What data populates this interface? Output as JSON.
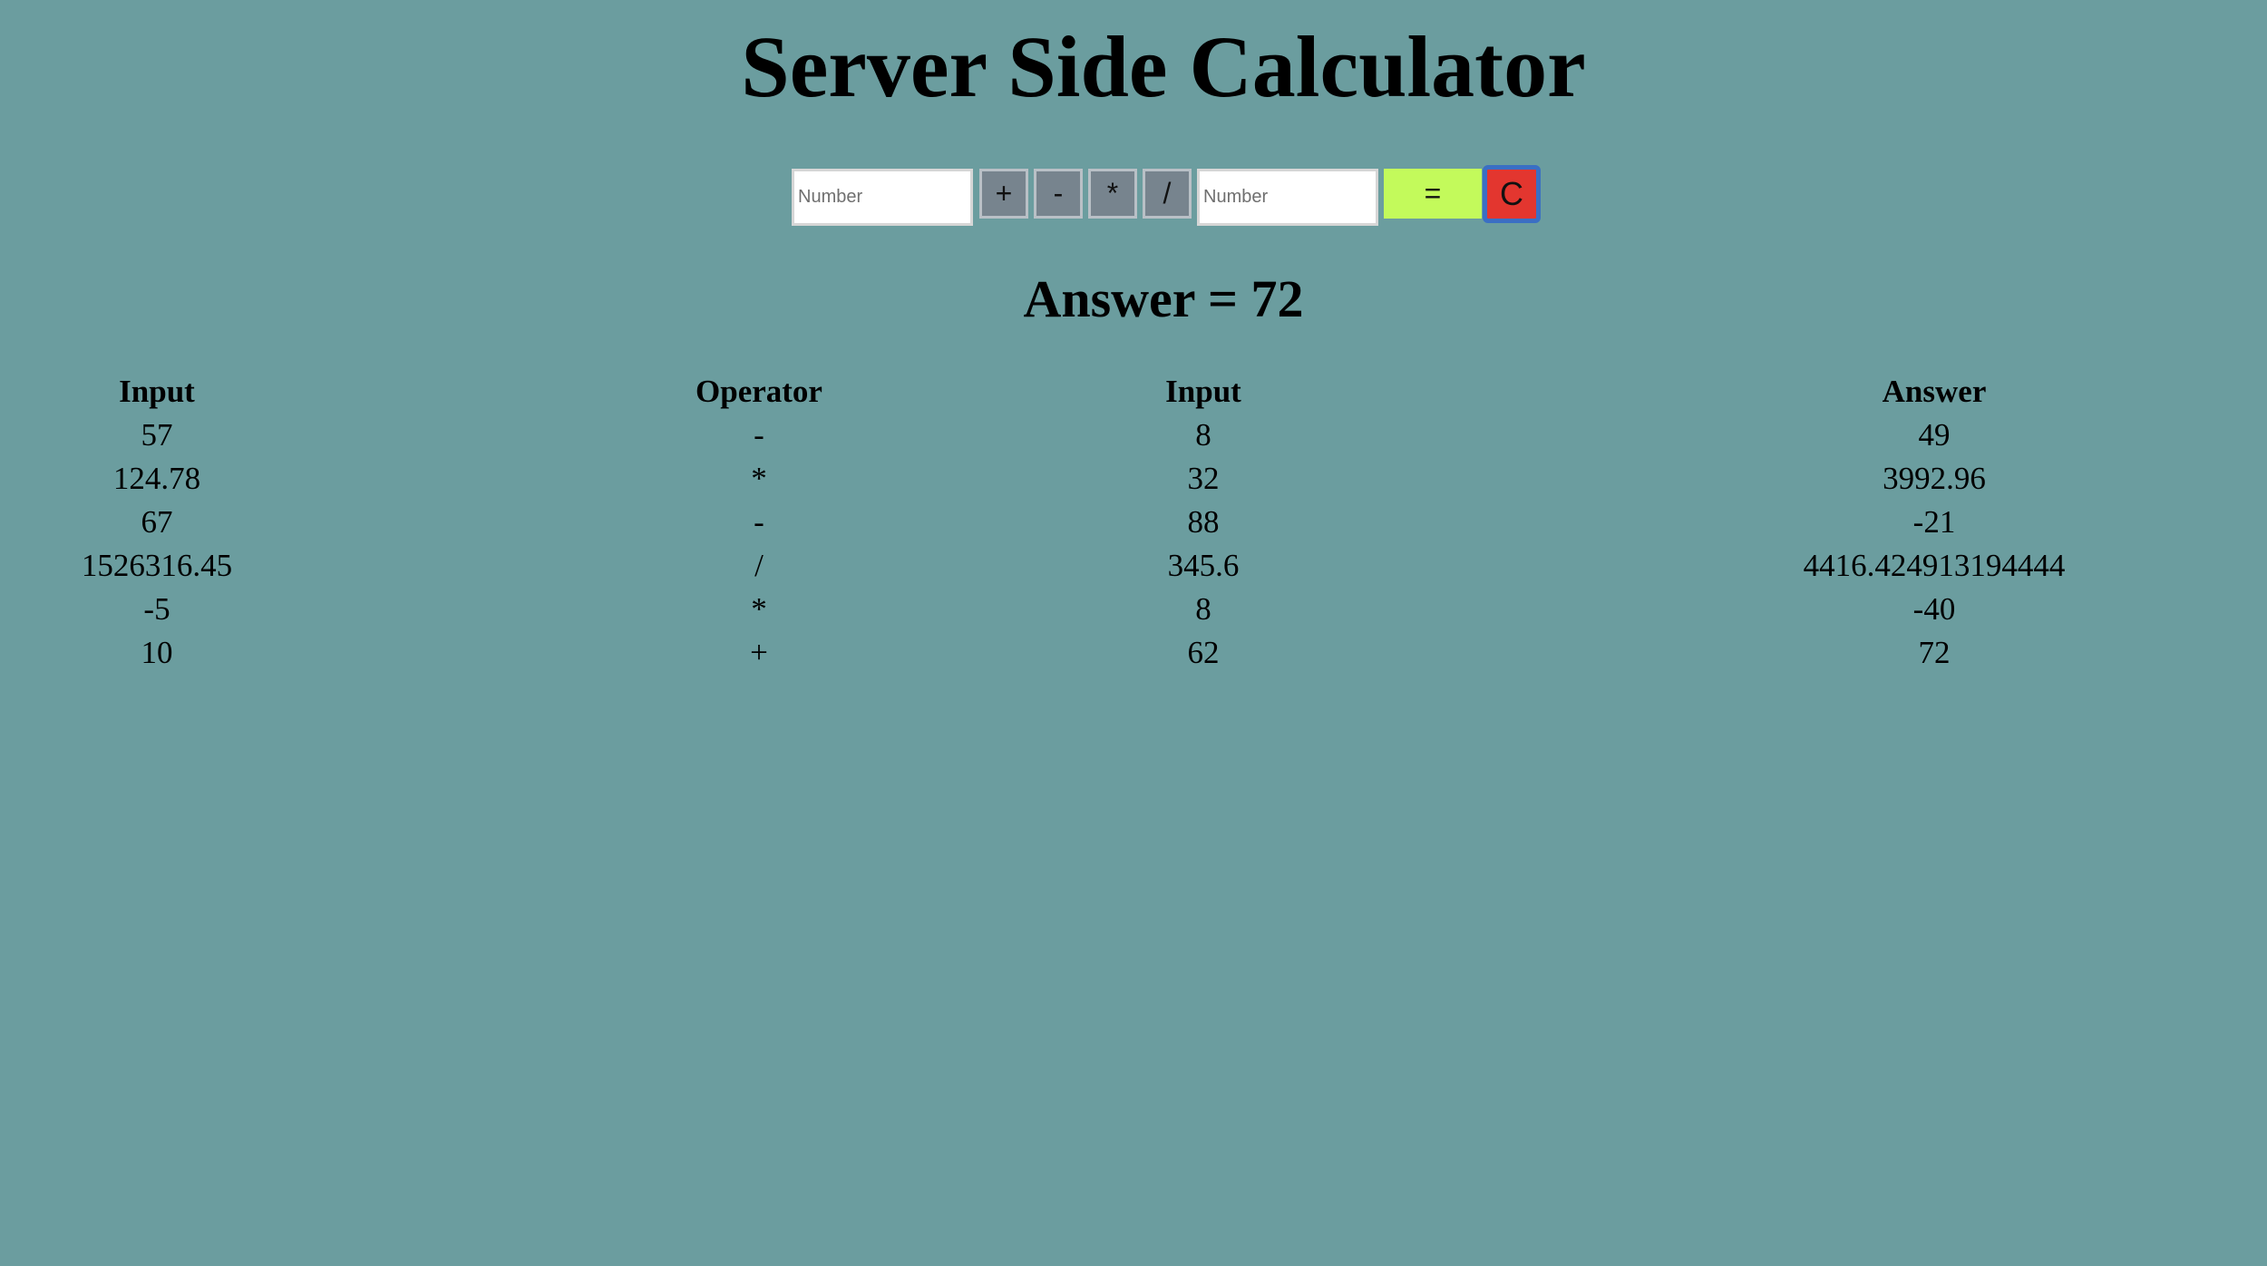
{
  "page": {
    "title": "Server Side Calculator",
    "background_color": "#6b9d9f"
  },
  "calculator": {
    "first_input": {
      "placeholder": "Number",
      "value": ""
    },
    "second_input": {
      "placeholder": "Number",
      "value": ""
    },
    "operators": [
      "+",
      "-",
      "*",
      "/"
    ],
    "equals_label": "=",
    "clear_label": "C",
    "equals_color": "#c3fa5b",
    "clear_color": "#e3362f"
  },
  "answer": {
    "text": "Answer = 72"
  },
  "history": {
    "headers": [
      "Input",
      "Operator",
      "Input",
      "Answer"
    ],
    "rows": [
      [
        "57",
        "-",
        "8",
        "49"
      ],
      [
        "124.78",
        "*",
        "32",
        "3992.96"
      ],
      [
        "67",
        "-",
        "88",
        "-21"
      ],
      [
        "1526316.45",
        "/",
        "345.6",
        "4416.424913194444"
      ],
      [
        "-5",
        "*",
        "8",
        "-40"
      ],
      [
        "10",
        "+",
        "62",
        "72"
      ]
    ]
  }
}
